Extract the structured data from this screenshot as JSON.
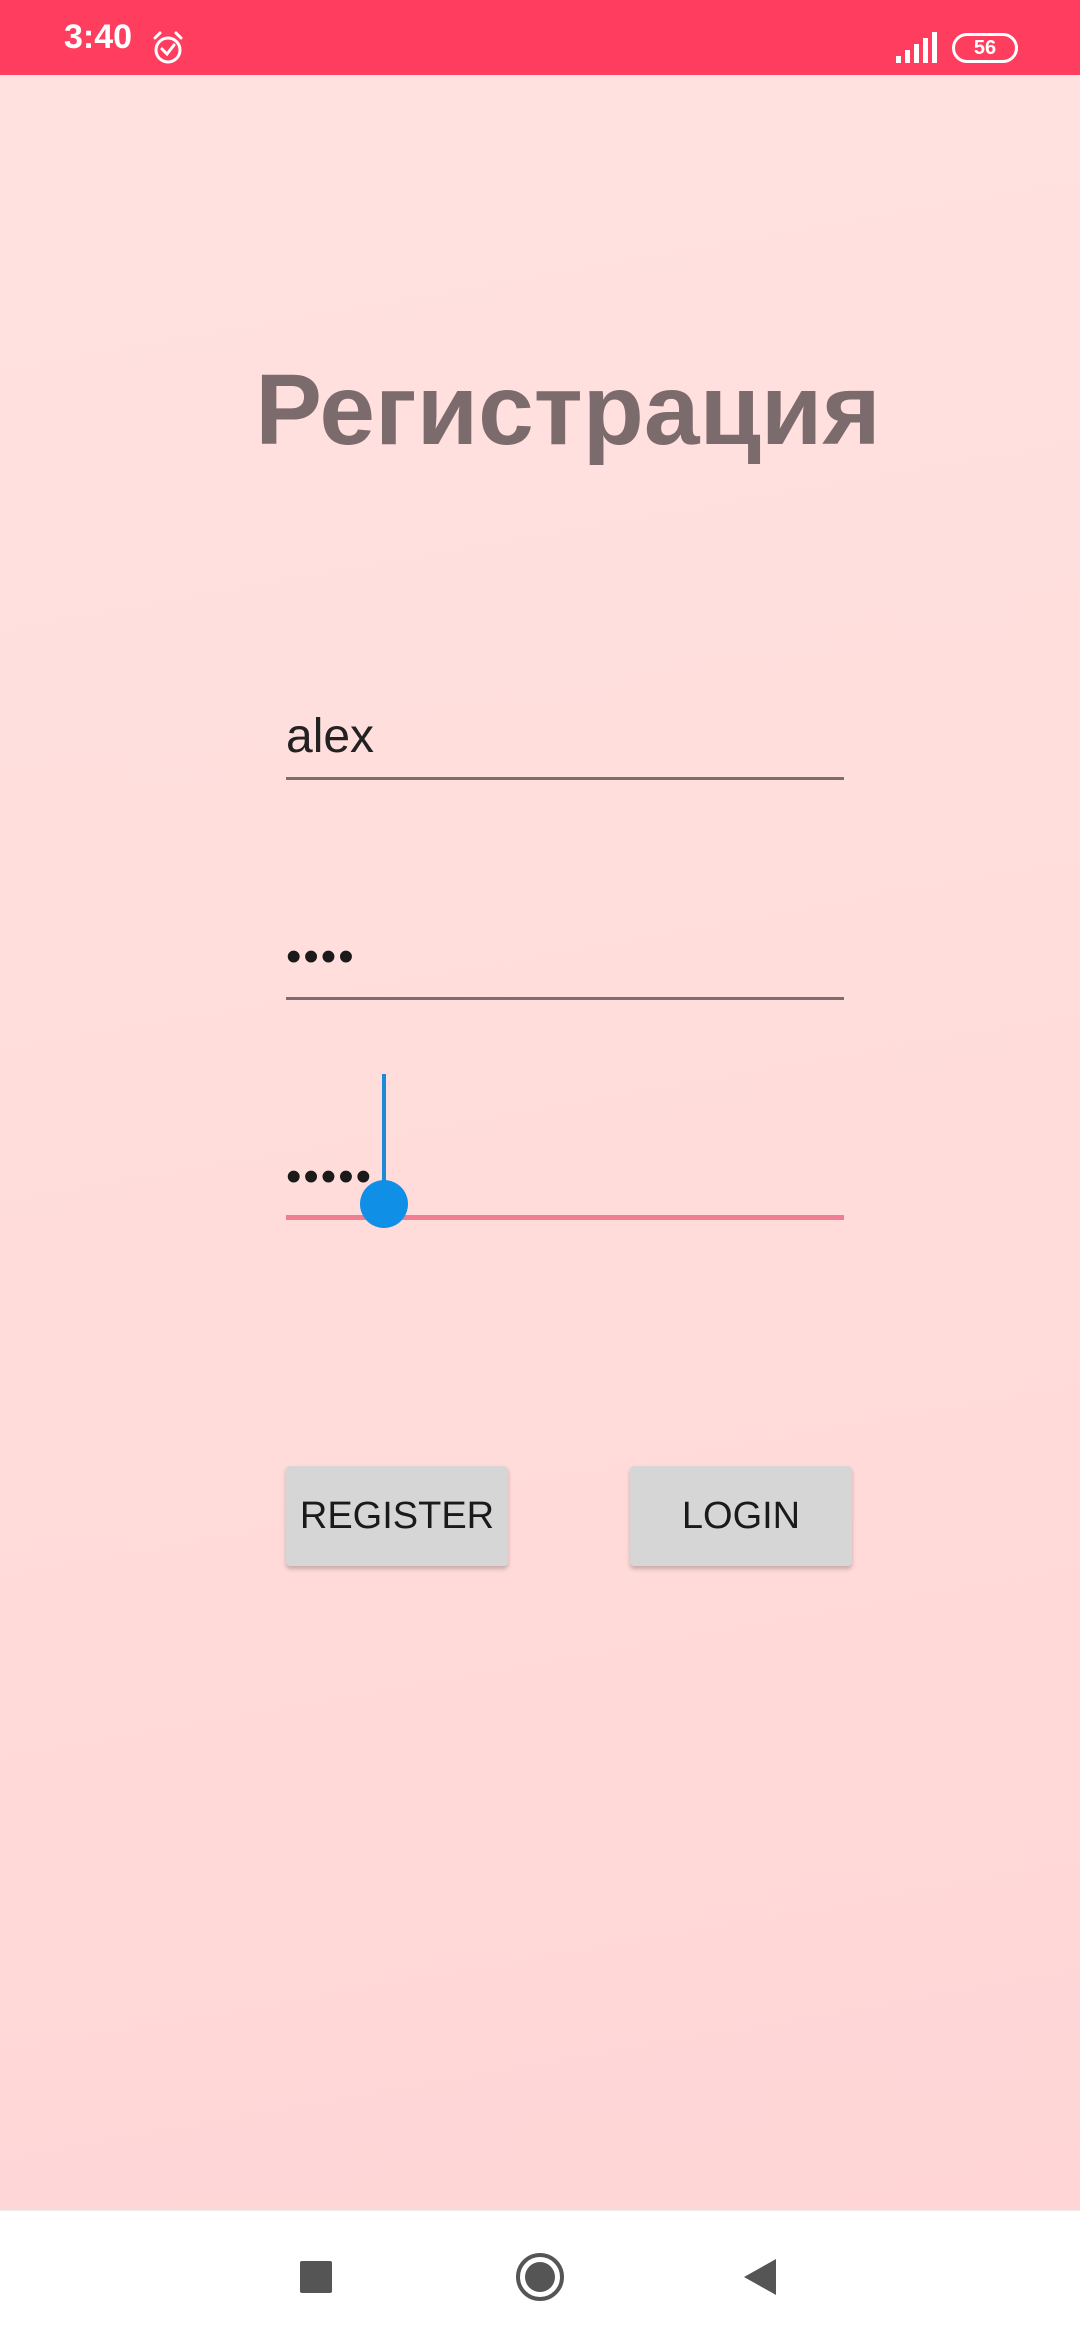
{
  "status_bar": {
    "time": "3:40",
    "battery": "56",
    "icons": [
      "alarm-icon",
      "signal-icon",
      "battery-icon"
    ]
  },
  "screen": {
    "title": "Регистрация"
  },
  "form": {
    "username": {
      "value": "alex"
    },
    "password": {
      "value": "••••"
    },
    "confirm_password": {
      "value": "•••••"
    }
  },
  "buttons": {
    "register": "REGISTER",
    "login": "LOGIN"
  },
  "nav_bar": {
    "icons": [
      "recents-icon",
      "home-icon",
      "back-icon"
    ]
  },
  "colors": {
    "status_bar": "#ff3d5f",
    "background": "#ffdcda",
    "title": "#7c6b6c",
    "focused_underline": "#f07e92",
    "cursor": "#0f8fe6",
    "button": "#d6d6d6"
  }
}
